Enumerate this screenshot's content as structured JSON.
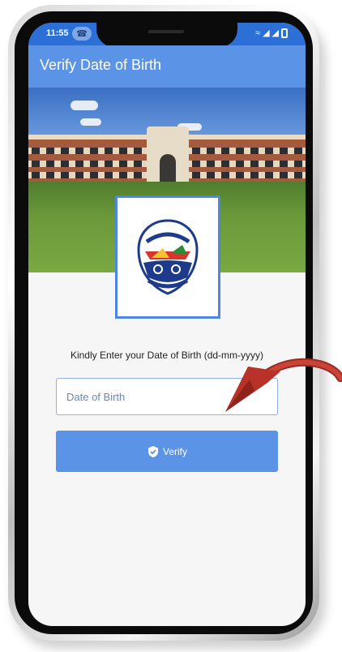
{
  "status_bar": {
    "time": "11:55",
    "call_icon": "phone-icon",
    "icons": [
      "wifi-icon",
      "signal-icon",
      "signal-icon",
      "battery-icon"
    ]
  },
  "app_bar": {
    "title": "Verify Date of Birth"
  },
  "banner": {
    "image": "college-building-photo"
  },
  "logo": {
    "icon": "school-emblem-icon"
  },
  "form": {
    "prompt": "Kindly Enter your Date of Birth (dd-mm-yyyy)",
    "dob_placeholder": "Date of Birth",
    "dob_value": "",
    "verify_label": "Verify",
    "verify_icon": "shield-check-icon"
  },
  "colors": {
    "accent": "#5b93e6",
    "status_bar": "#2c6fd6",
    "input_border": "#8fb0ea",
    "arrow": "#b8322a"
  }
}
